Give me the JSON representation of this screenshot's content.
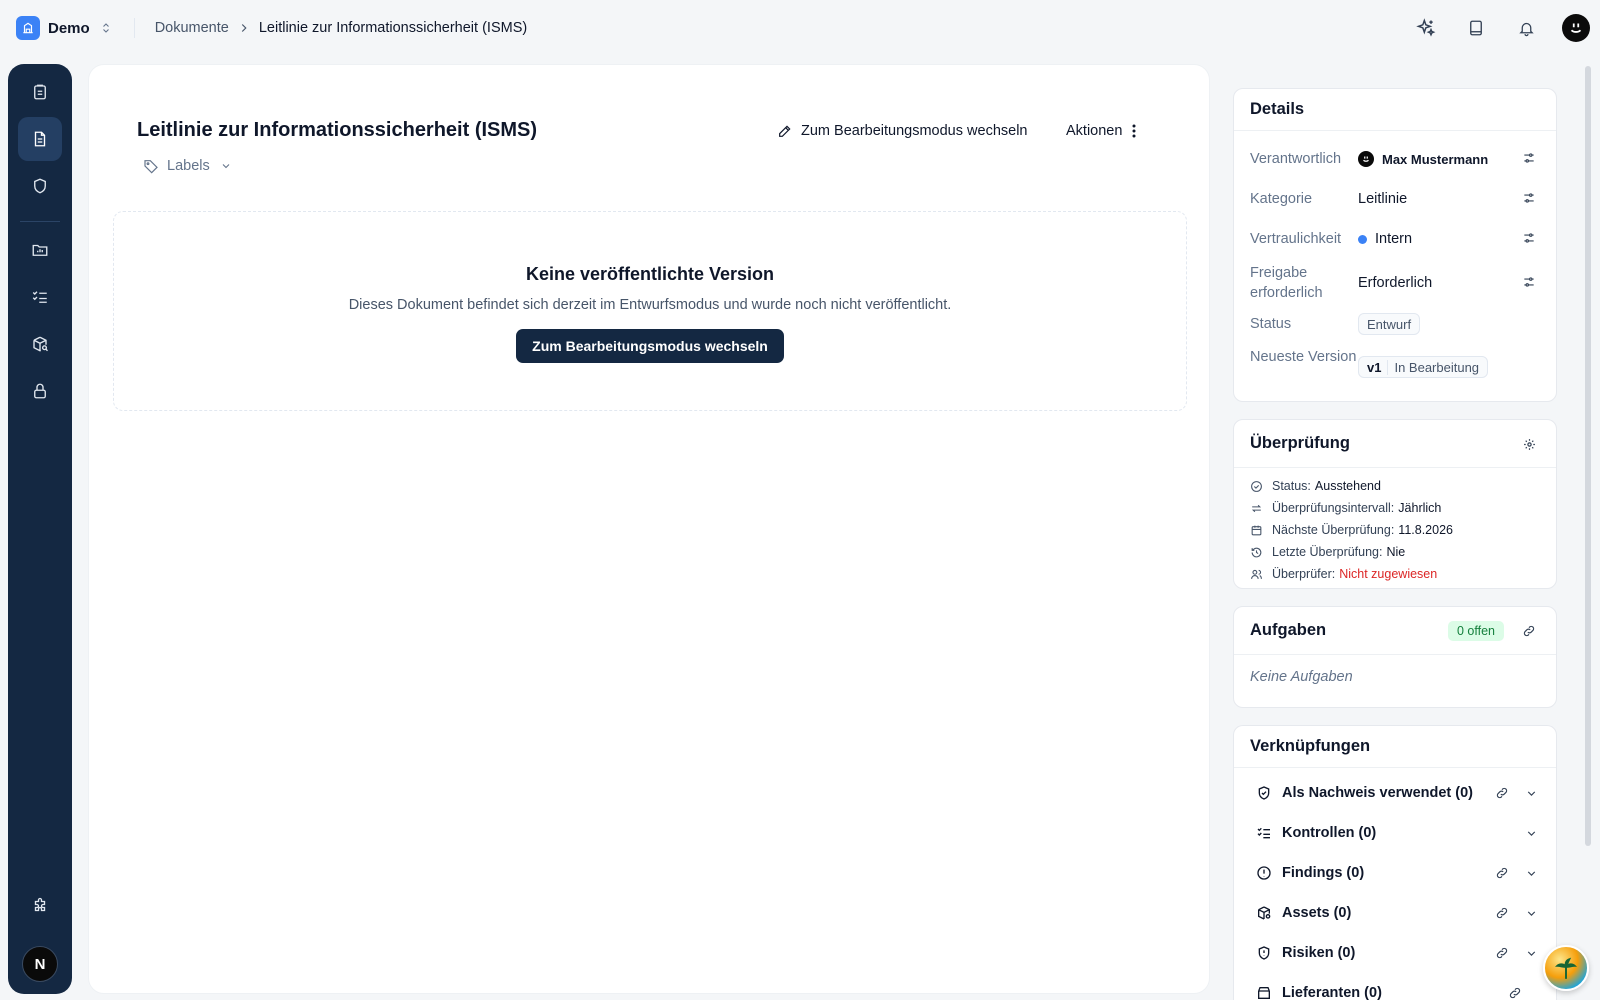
{
  "workspace": {
    "name": "Demo"
  },
  "breadcrumb": {
    "parent": "Dokumente",
    "current": "Leitlinie zur Informationssicherheit (ISMS)"
  },
  "document": {
    "title": "Leitlinie zur Informationssicherheit (ISMS)",
    "labels_label": "Labels",
    "edit_mode_label": "Zum Bearbeitungsmodus wechseln",
    "actions_label": "Aktionen"
  },
  "empty_state": {
    "title": "Keine veröffentlichte Version",
    "description": "Dieses Dokument befindet sich derzeit im Entwurfsmodus und wurde noch nicht veröffentlicht.",
    "button": "Zum Bearbeitungsmodus wechseln"
  },
  "sidebar": {
    "items": [
      {
        "icon": "clipboard-list-icon",
        "active": false
      },
      {
        "icon": "document-icon",
        "active": true
      },
      {
        "icon": "shield-icon",
        "active": false
      },
      {
        "icon": "folder-chart-icon",
        "active": false
      },
      {
        "icon": "checklist-icon",
        "active": false
      },
      {
        "icon": "package-search-icon",
        "active": false
      },
      {
        "icon": "lock-icon",
        "active": false
      },
      {
        "icon": "puzzle-icon",
        "active": false
      }
    ],
    "avatar_initial": "N"
  },
  "details": {
    "title": "Details",
    "owner_label": "Verantwortlich",
    "owner_value": "Max Mustermann",
    "category_label": "Kategorie",
    "category_value": "Leitlinie",
    "confidentiality_label": "Vertraulichkeit",
    "confidentiality_value": "Intern",
    "confidentiality_color": "#3b82f6",
    "approval_label": "Freigabe erforderlich",
    "approval_value": "Erforderlich",
    "status_label": "Status",
    "status_value": "Entwurf",
    "version_label": "Neueste Version",
    "version_number": "v1",
    "version_status": "In Bearbeitung"
  },
  "review": {
    "title": "Überprüfung",
    "status_label": "Status:",
    "status_value": "Ausstehend",
    "interval_label": "Überprüfungsintervall:",
    "interval_value": "Jährlich",
    "next_label": "Nächste Überprüfung:",
    "next_value": "11.8.2026",
    "last_label": "Letzte Überprüfung:",
    "last_value": "Nie",
    "reviewer_label": "Überprüfer:",
    "reviewer_value": "Nicht zugewiesen"
  },
  "tasks": {
    "title": "Aufgaben",
    "badge": "0 offen",
    "empty": "Keine Aufgaben"
  },
  "links": {
    "title": "Verknüpfungen",
    "items": [
      {
        "label": "Als Nachweis verwendet (0)",
        "icon": "shield-check-icon"
      },
      {
        "label": "Kontrollen (0)",
        "icon": "checklist-icon"
      },
      {
        "label": "Findings (0)",
        "icon": "alert-circle-icon"
      },
      {
        "label": "Assets (0)",
        "icon": "package-search-icon"
      },
      {
        "label": "Risiken (0)",
        "icon": "shield-alert-icon"
      },
      {
        "label": "Lieferanten (0)",
        "icon": "store-icon"
      }
    ]
  }
}
